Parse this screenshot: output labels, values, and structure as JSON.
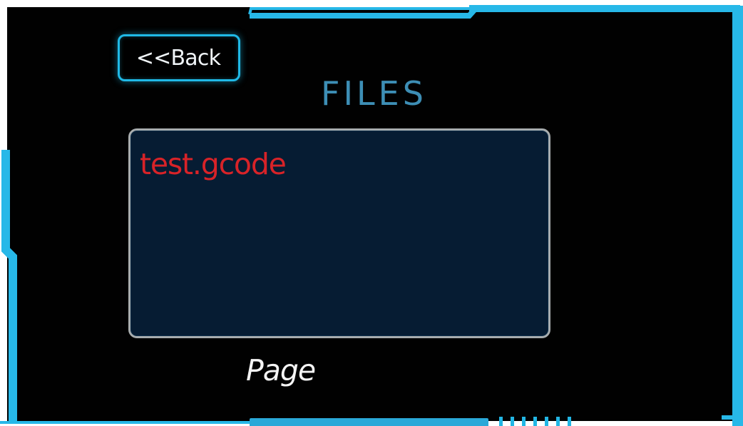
{
  "header": {
    "back_label": "<<Back",
    "title": "FILES"
  },
  "file_list": {
    "items": [
      {
        "name": "test.gcode"
      }
    ]
  },
  "footer": {
    "page_label": "Page"
  },
  "colors": {
    "background": "#010101",
    "accent": "#20b9e6",
    "title": "#3d8eb5",
    "file_list_background": "#061c33",
    "file_text": "#d82328",
    "border_gray": "#a7acae"
  },
  "icons": {
    "frame": "cyan-frame-decoration"
  }
}
